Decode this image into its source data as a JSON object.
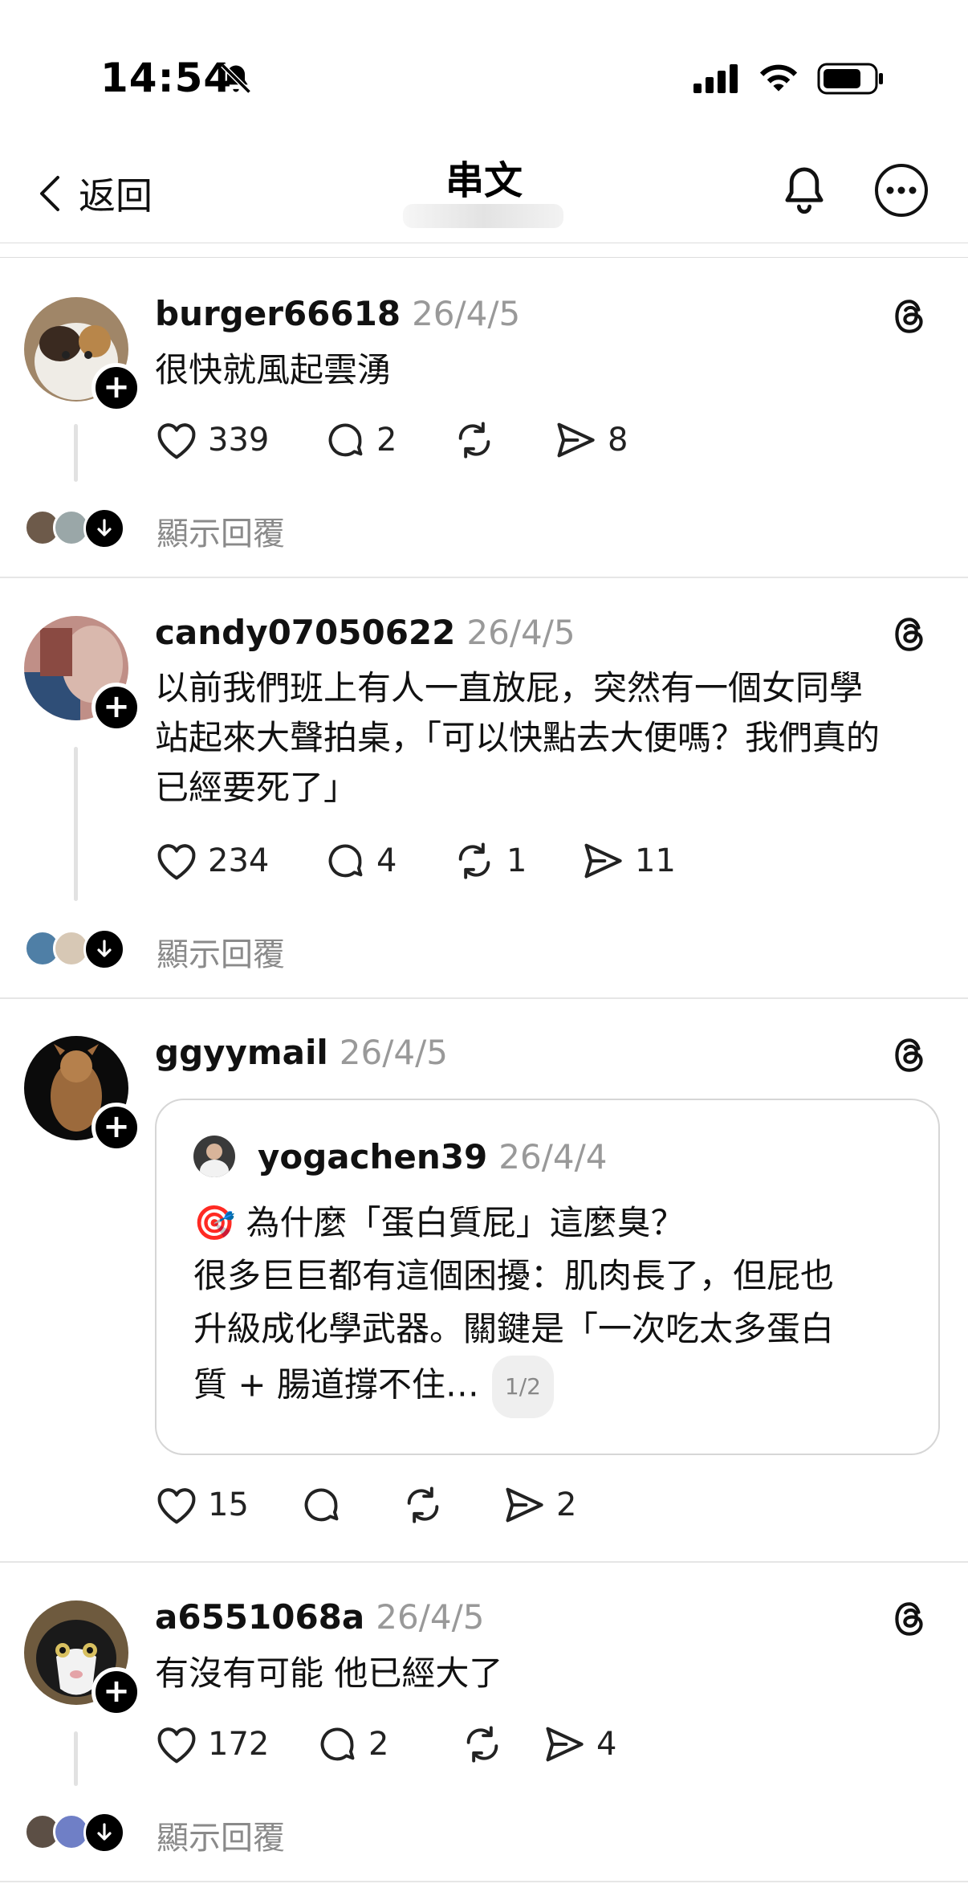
{
  "status": {
    "time": "14:54"
  },
  "nav": {
    "back_label": "返回",
    "title": "串文"
  },
  "posts": [
    {
      "username": "burger66618",
      "date": "26/4/5",
      "text": "很快就風起雲湧",
      "likes": "339",
      "comments": "2",
      "reposts": "",
      "shares": "8",
      "show_replies": "顯示回覆"
    },
    {
      "username": "candy07050622",
      "date": "26/4/5",
      "text_lines": [
        "以前我們班上有人一直放屁，突然有一個女同學",
        "站起來大聲拍桌，「可以快點去大便嗎？我們真的",
        "已經要死了」"
      ],
      "likes": "234",
      "comments": "4",
      "reposts": "1",
      "shares": "11",
      "show_replies": "顯示回覆"
    },
    {
      "username": "ggyymail",
      "date": "26/4/5",
      "quote": {
        "username": "yogachen39",
        "date": "26/4/4",
        "line1": "為什麼「蛋白質屁」這麼臭？",
        "line2": "很多巨巨都有這個困擾：肌肉長了，但屁也",
        "line3": "升級成化學武器。關鍵是「一次吃太多蛋白",
        "line4": "質 + 腸道撐不住…",
        "page": "1/2"
      },
      "likes": "15",
      "comments": "",
      "reposts": "",
      "shares": "2"
    },
    {
      "username": "a6551068a",
      "date": "26/4/5",
      "text": "有沒有可能 他已經大了",
      "likes": "172",
      "comments": "2",
      "reposts": "",
      "shares": "4",
      "show_replies": "顯示回覆"
    }
  ],
  "icons": {
    "status": [
      "bell-slash-icon",
      "cellular-signal-icon",
      "wifi-icon",
      "battery-icon"
    ],
    "nav": [
      "chevron-left-icon",
      "bell-icon",
      "more-icon"
    ],
    "post": [
      "threads-logo-icon",
      "heart-icon",
      "comment-icon",
      "repost-icon",
      "share-icon",
      "follow-plus-icon",
      "down-arrow-icon"
    ],
    "quote": [
      "target-dart-emoji"
    ]
  },
  "colors": {
    "text": "#000000",
    "secondary": "#999999",
    "divider": "#e6e6e6",
    "badge": "#000000"
  }
}
